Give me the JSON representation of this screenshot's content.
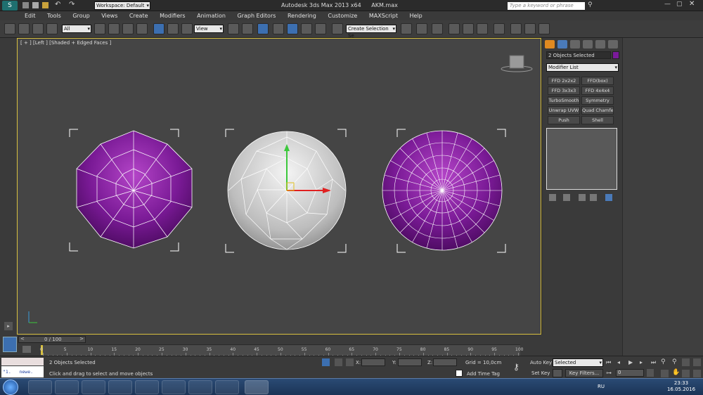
{
  "titlebar": {
    "workspace_label": "Workspace: Default",
    "app_title": "Autodesk 3ds Max 2013 x64",
    "file_name": "AKM.max",
    "search_placeholder": "Type a keyword or phrase"
  },
  "menu": [
    "Edit",
    "Tools",
    "Group",
    "Views",
    "Create",
    "Modifiers",
    "Animation",
    "Graph Editors",
    "Rendering",
    "Customize",
    "MAXScript",
    "Help"
  ],
  "toolbar": {
    "selection_filter": "All",
    "ref_coord": "View",
    "named_selection": "Create Selection Se"
  },
  "viewport": {
    "label": "[ + ] [Left ] [Shaded + Edged Faces ]"
  },
  "command_panel": {
    "selection_name": "2 Objects Selected",
    "selection_color": "#7a1a9a",
    "modifier_list": "Modifier List",
    "buttons": [
      "FFD 2x2x2",
      "FFD(box)",
      "FFD 3x3x3",
      "FFD 4x4x4",
      "TurboSmooth",
      "Symmetry",
      "Unwrap UVW",
      "Quad Chamfer",
      "Push",
      "Shell"
    ]
  },
  "timeline": {
    "frame_counter": "0 / 100",
    "ticks": [
      "0",
      "5",
      "10",
      "15",
      "20",
      "25",
      "30",
      "35",
      "40",
      "45",
      "50",
      "55",
      "60",
      "65",
      "70",
      "75",
      "80",
      "85",
      "90",
      "95",
      "100"
    ]
  },
  "status": {
    "script_text": "\"1.   newe.",
    "objects_selected": "2 Objects Selected",
    "prompt": "Click and drag to select and move objects",
    "x_label": "X:",
    "y_label": "Y:",
    "z_label": "Z:",
    "grid": "Grid = 10,0cm",
    "add_time_tag": "Add Time Tag",
    "auto_key": "Auto Key",
    "set_key": "Set Key",
    "selected": "Selected",
    "key_filters": "Key Filters...",
    "frame_value": "0"
  },
  "taskbar": {
    "language": "RU",
    "time": "23:33",
    "date": "16.05.2016"
  }
}
